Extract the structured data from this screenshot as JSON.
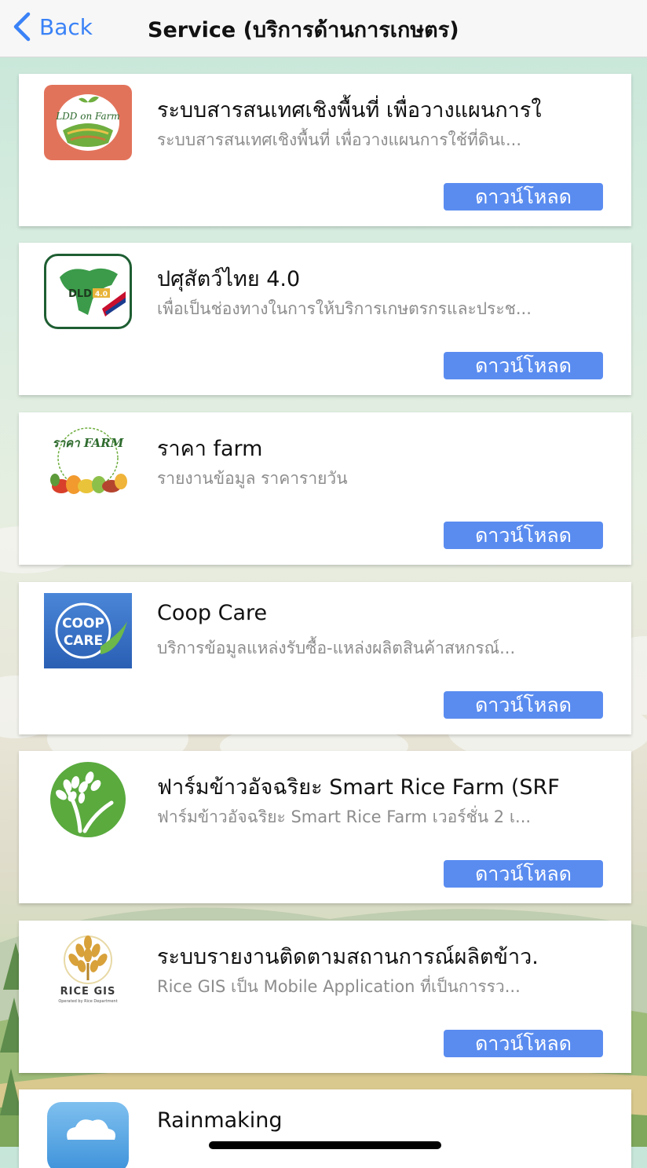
{
  "nav": {
    "back_label": "Back",
    "title": "Service (บริการด้านการเกษตร)"
  },
  "colors": {
    "accent": "#3a82f7",
    "download_button": "#5a8cf0"
  },
  "apps": [
    {
      "title": "ระบบสารสนเทศเชิงพื้นที่ เพื่อวางแผนการใ",
      "description": "ระบบสารสนเทศเชิงพื้นที่ เพื่อวางแผนการใช้ที่ดินเ...",
      "button": "ดาวน์โหลด",
      "icon": "ldd-on-farm-icon",
      "icon_text": "LDD on Farm"
    },
    {
      "title": "ปศุสัตว์ไทย 4.0",
      "description": "เพื่อเป็นช่องทางในการให้บริการเกษตรกรและประช...",
      "button": "ดาวน์โหลด",
      "icon": "dld-4-0-icon",
      "icon_text": "DLD 4.0"
    },
    {
      "title": "ราคา farm",
      "description": "รายงานข้อมูล ราคารายวัน",
      "button": "ดาวน์โหลด",
      "icon": "raka-farm-icon",
      "icon_text": "ราคา FARM"
    },
    {
      "title": "Coop Care",
      "description": "บริการข้อมูลแหล่งรับซื้อ-แหล่งผลิตสินค้าสหกรณ์...",
      "button": "ดาวน์โหลด",
      "icon": "coop-care-icon",
      "icon_text": "COOP CARE"
    },
    {
      "title": "ฟาร์มข้าวอัจฉริยะ Smart Rice Farm (SRF",
      "description": "ฟาร์มข้าวอัจฉริยะ Smart Rice Farm เวอร์ชั่น 2 เ...",
      "button": "ดาวน์โหลด",
      "icon": "smart-rice-farm-icon",
      "icon_text": ""
    },
    {
      "title": "ระบบรายงานติดตามสถานการณ์ผลิตข้าว.",
      "description": "Rice GIS เป็น Mobile Application ที่เป็นการรว...",
      "button": "ดาวน์โหลด",
      "icon": "rice-gis-icon",
      "icon_text": "RICE GIS"
    },
    {
      "title": "Rainmaking",
      "description": "",
      "button": "",
      "icon": "rainmaking-cloud-icon",
      "icon_text": ""
    }
  ]
}
